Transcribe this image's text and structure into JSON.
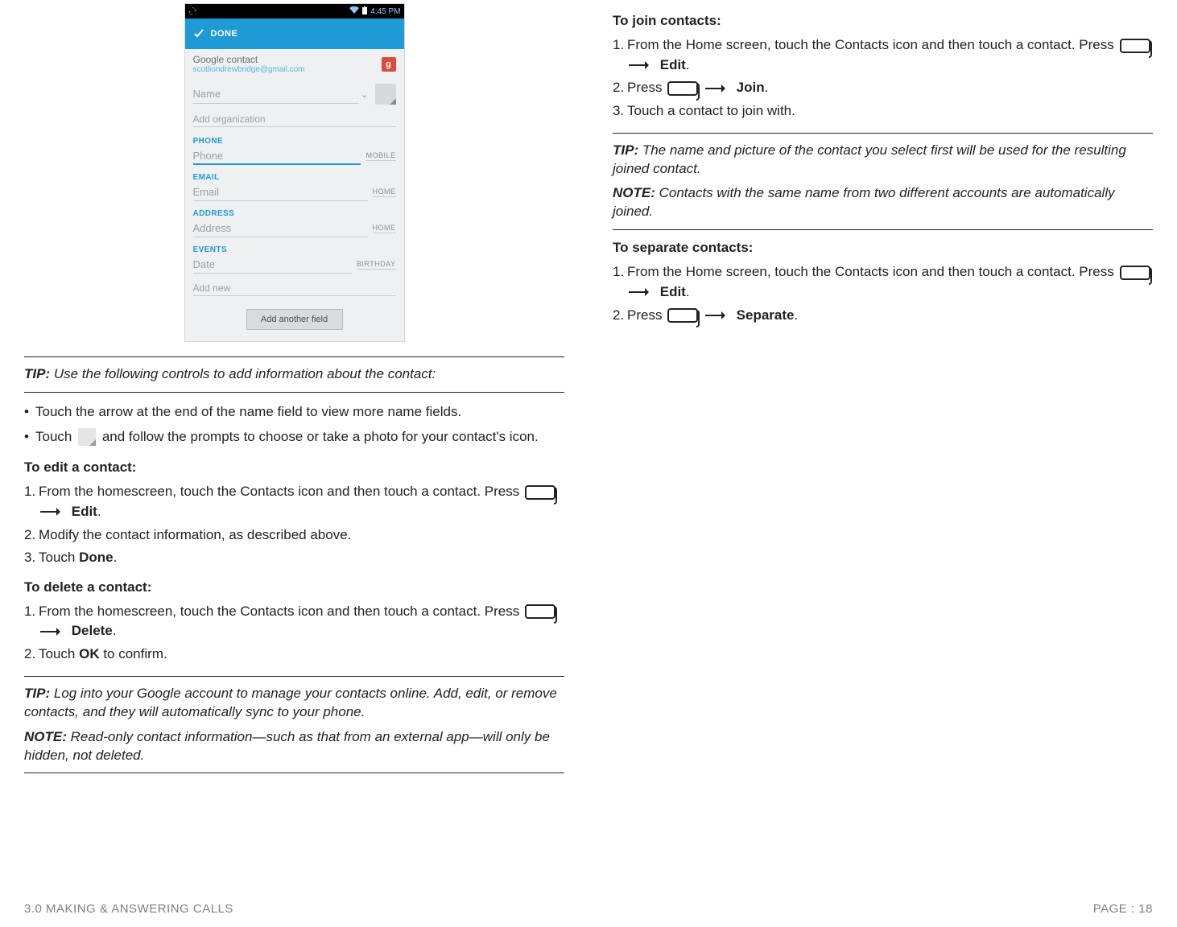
{
  "phone": {
    "statusbar": {
      "time": "4:45 PM"
    },
    "donebar": {
      "label": "DONE"
    },
    "google": {
      "title": "Google contact",
      "email": "scotliondrewbridge@gmail.com",
      "g": "g"
    },
    "name": {
      "placeholder": "Name"
    },
    "addorg": "Add organization",
    "sections": {
      "phone": "PHONE",
      "email": "EMAIL",
      "address": "ADDRESS",
      "events": "EVENTS"
    },
    "fields": {
      "phone": "Phone",
      "phone_type": "MOBILE",
      "email": "Email",
      "email_type": "HOME",
      "address": "Address",
      "address_type": "HOME",
      "date": "Date",
      "date_type": "BIRTHDAY",
      "addnew": "Add new"
    },
    "addfield_btn": "Add another field"
  },
  "left": {
    "tip1_label": "TIP:",
    "tip1_text": " Use the following controls to add information about the contact:",
    "bullet1": "Touch the arrow at the end of the name field to view more name fields.",
    "bullet2a": "Touch ",
    "bullet2b": " and follow the prompts to choose or take a photo for your contact's icon.",
    "edit_h": "To edit a contact:",
    "edit_1a": "From the homescreen, touch the Contacts icon and then touch a contact. Press ",
    "edit_1b": "Edit",
    "edit_1c": ".",
    "edit_2": "Modify the contact information, as described above.",
    "edit_3a": "Touch ",
    "edit_3b": "Done",
    "edit_3c": ".",
    "delete_h": "To delete a contact:",
    "delete_1a": "From the homescreen, touch the Contacts icon and then touch a contact. Press ",
    "delete_1b": "Delete",
    "delete_1c": ".",
    "delete_2a": "Touch ",
    "delete_2b": "OK",
    "delete_2c": " to confirm.",
    "tip2_label": "TIP:",
    "tip2_text": " Log into your Google account to manage your contacts online. Add, edit, or remove contacts, and they will automatically sync to your phone.",
    "note_label": "NOTE:",
    "note_text": " Read-only contact information—such as that from an external app—will only be hidden, not deleted."
  },
  "right": {
    "join_h": "To join contacts:",
    "join_1a": "From the Home screen, touch the Contacts icon and then touch a contact. Press ",
    "join_1b": "Edit",
    "join_1c": ".",
    "join_2a": "Press ",
    "join_2b": "Join",
    "join_2c": ".",
    "join_3": "Touch a contact to join with.",
    "tip_label": "TIP:",
    "tip_text": " The name and picture of the contact you select first will be used for the resulting joined contact.",
    "note_label": "NOTE:",
    "note_text": " Contacts with the same name from two different accounts are automatically joined.",
    "sep_h": "To separate contacts:",
    "sep_1a": "From the Home screen, touch the Contacts icon and then touch a contact. Press ",
    "sep_1b": "Edit",
    "sep_1c": ".",
    "sep_2a": "Press ",
    "sep_2b": "Separate",
    "sep_2c": "."
  },
  "footer": {
    "section": "3.0 MAKING & ANSWERING CALLS",
    "page": "PAGE : 18"
  }
}
